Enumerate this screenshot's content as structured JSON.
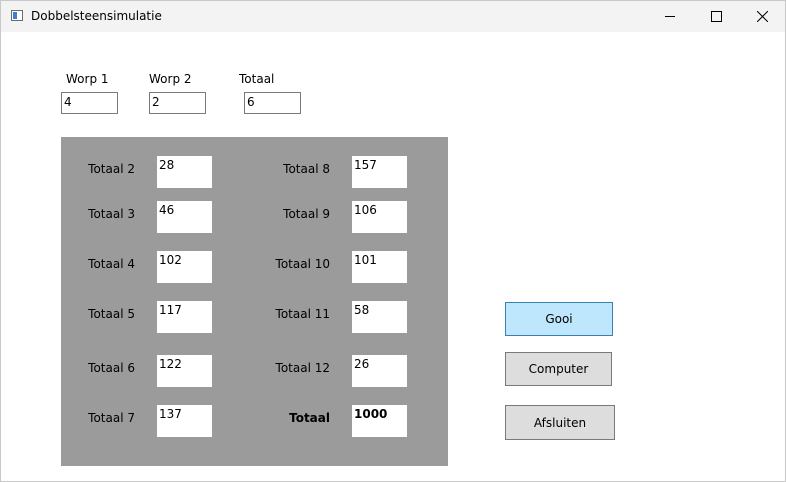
{
  "window": {
    "title": "Dobbelsteensimulatie"
  },
  "controls": {
    "minimize": "minimize-icon",
    "maximize": "maximize-icon",
    "close": "close-icon"
  },
  "throws": {
    "worp1": {
      "label": "Worp 1",
      "value": "4"
    },
    "worp2": {
      "label": "Worp 2",
      "value": "2"
    },
    "totaal": {
      "label": "Totaal",
      "value": "6"
    }
  },
  "stats": {
    "left": [
      {
        "label": "Totaal 2",
        "value": "28"
      },
      {
        "label": "Totaal 3",
        "value": "46"
      },
      {
        "label": "Totaal 4",
        "value": "102"
      },
      {
        "label": "Totaal 5",
        "value": "117"
      },
      {
        "label": "Totaal 6",
        "value": "122"
      },
      {
        "label": "Totaal 7",
        "value": "137"
      }
    ],
    "right": [
      {
        "label": "Totaal 8",
        "value": "157"
      },
      {
        "label": "Totaal 9",
        "value": "106"
      },
      {
        "label": "Totaal 10",
        "value": "101"
      },
      {
        "label": "Totaal 11",
        "value": "58"
      },
      {
        "label": "Totaal 12",
        "value": "26"
      },
      {
        "label": "Totaal",
        "value": "1000"
      }
    ]
  },
  "buttons": {
    "gooi": "Gooi",
    "computer": "Computer",
    "afsluiten": "Afsluiten"
  }
}
